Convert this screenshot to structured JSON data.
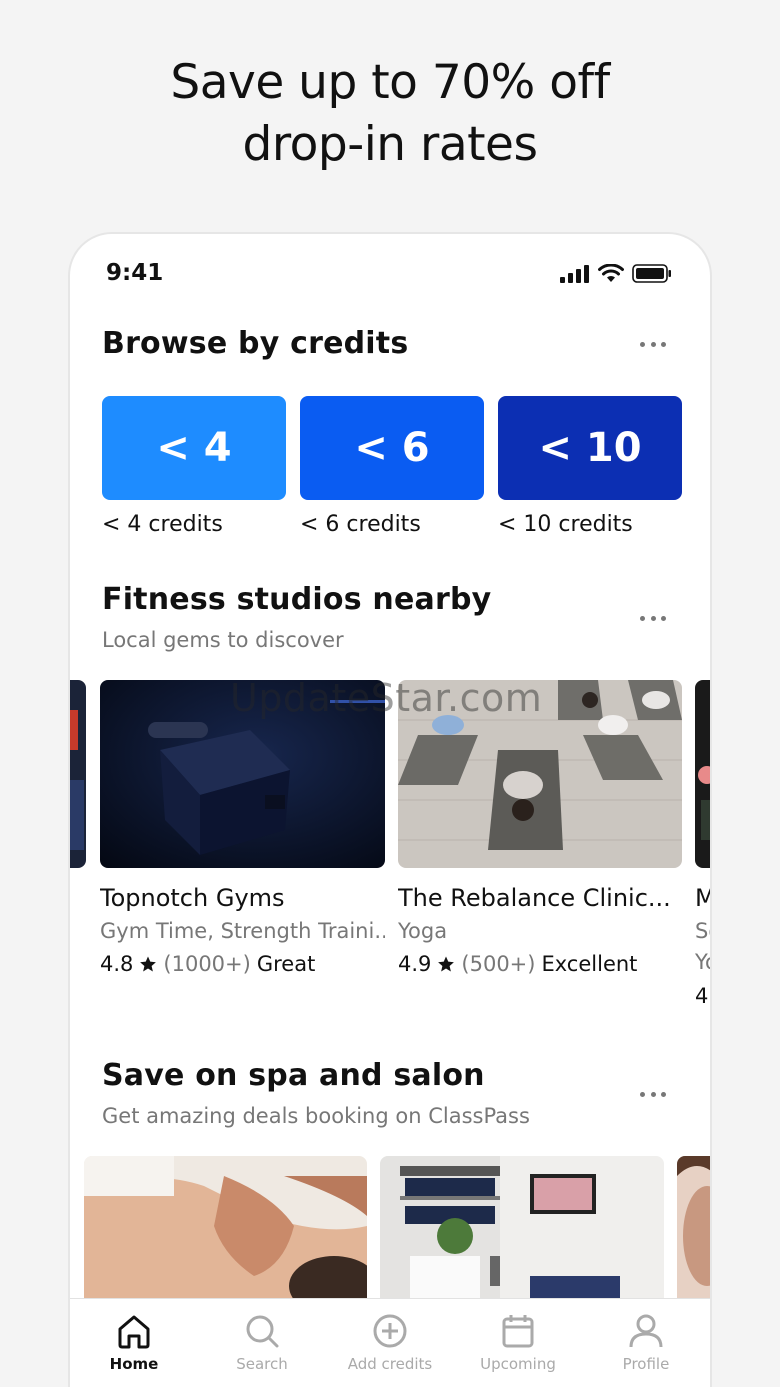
{
  "headline": {
    "line1": "Save up to 70% off",
    "line2": "drop-in rates"
  },
  "status": {
    "time": "9:41"
  },
  "credits_section": {
    "title": "Browse by credits",
    "tiles": [
      {
        "value": "< 4",
        "label": "< 4 credits",
        "color": "#1e8cff"
      },
      {
        "value": "< 6",
        "label": "< 6 credits",
        "color": "#0a5cf2"
      },
      {
        "value": "< 10",
        "label": "< 10 credits",
        "color": "#0c2fb3"
      }
    ]
  },
  "fitness_section": {
    "title": "Fitness studios nearby",
    "subtitle": "Local gems to discover",
    "cards": [
      {
        "name": "Topnotch Gyms",
        "category": "Gym Time, Strength Traini...",
        "rating": "4.8",
        "count": "(1000+)",
        "verdict": "Great"
      },
      {
        "name": "The Rebalance Clinic...",
        "category": "Yoga",
        "rating": "4.9",
        "count": "(500+)",
        "verdict": "Excellent"
      },
      {
        "name": "M",
        "category": "So",
        "rating": "4.",
        "count": "",
        "verdict": "",
        "extra": "Yo"
      }
    ]
  },
  "spa_section": {
    "title": "Save on spa and salon",
    "subtitle": "Get amazing deals booking on ClassPass"
  },
  "tabbar": {
    "items": [
      {
        "label": "Home",
        "icon": "home-icon",
        "active": true
      },
      {
        "label": "Search",
        "icon": "search-icon",
        "active": false
      },
      {
        "label": "Add credits",
        "icon": "add-circle-icon",
        "active": false
      },
      {
        "label": "Upcoming",
        "icon": "calendar-icon",
        "active": false
      },
      {
        "label": "Profile",
        "icon": "profile-icon",
        "active": false
      }
    ]
  },
  "watermark": "UpdateStar.com"
}
